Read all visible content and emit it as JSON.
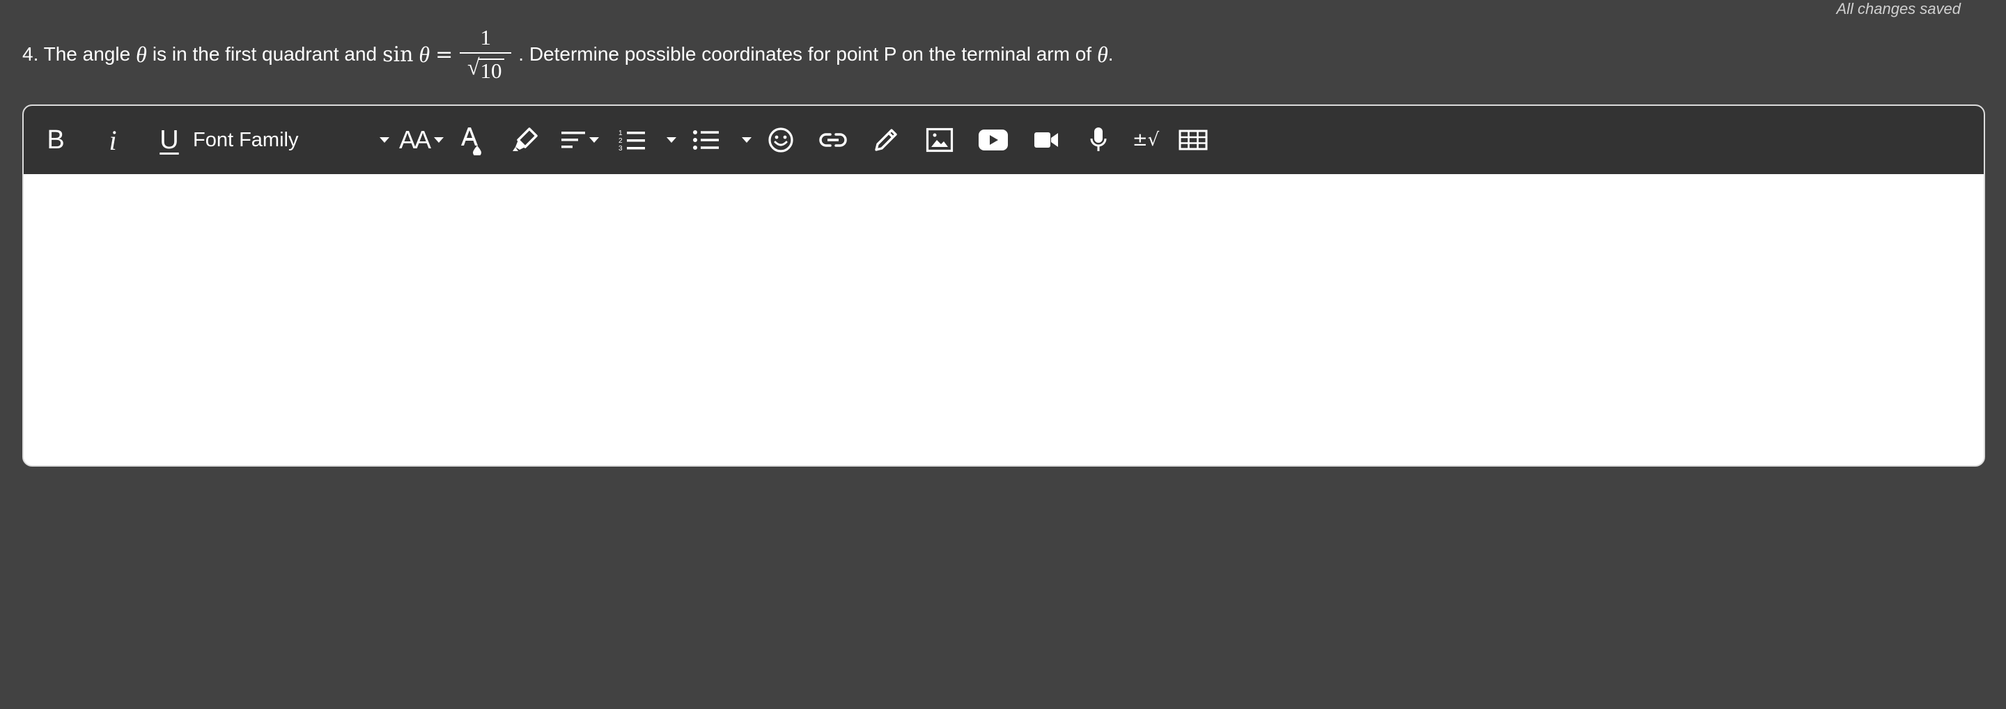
{
  "status": {
    "text": "All changes saved"
  },
  "question": {
    "prefix": "4. The angle",
    "var": "θ",
    "middle": "is in the first quadrant and",
    "func": "sin",
    "equals": "=",
    "numerator": "1",
    "denominator": "10",
    "suffix": ". Determine possible coordinates for point P on the terminal arm of",
    "end": "."
  },
  "toolbar": {
    "bold_label": "B",
    "italic_label": "i",
    "underline_label": "U",
    "font_family_label": "Font Family",
    "font_size_label": "AA",
    "math_label": "±√",
    "icons": [
      "bold-icon",
      "italic-icon",
      "underline-icon",
      "font-family-dropdown",
      "font-size-icon",
      "text-color-icon",
      "highlight-icon",
      "align-icon",
      "numbered-list-icon",
      "bulleted-list-icon",
      "emoji-icon",
      "link-icon",
      "draw-icon",
      "image-icon",
      "youtube-icon",
      "video-icon",
      "microphone-icon",
      "math-icon",
      "table-icon"
    ]
  },
  "colors": {
    "page_background": "#424242",
    "toolbar_background": "#333333",
    "editor_background": "#ffffff",
    "text": "#ffffff"
  }
}
